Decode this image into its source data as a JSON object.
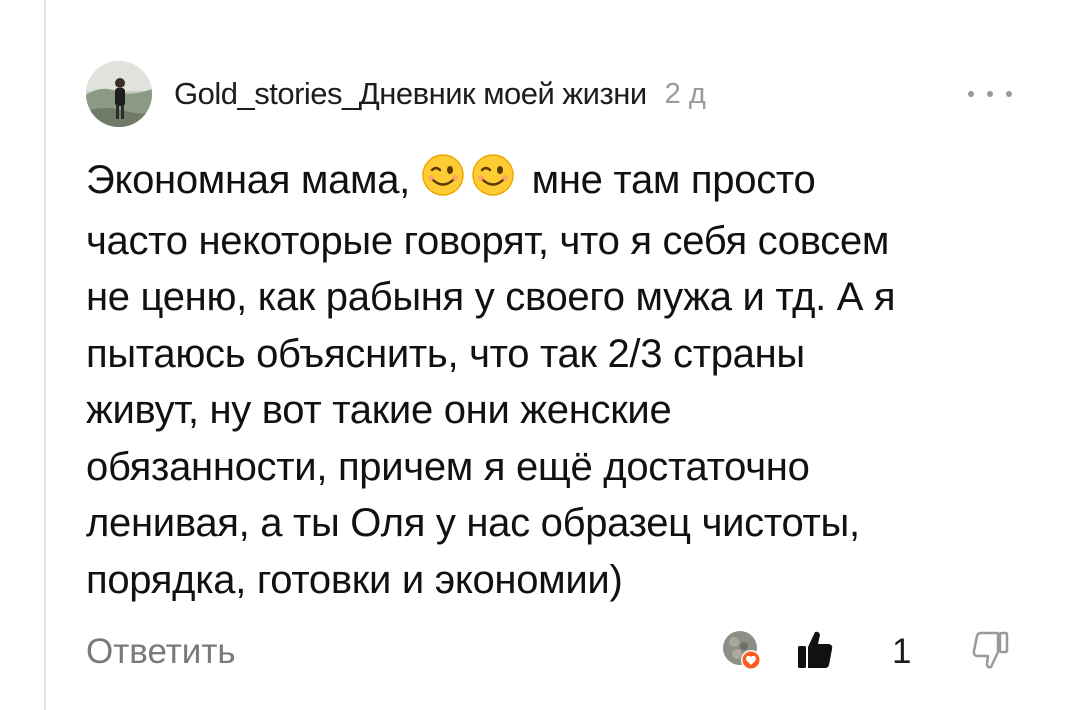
{
  "comment": {
    "author": "Gold_stories_Дневник моей жизни",
    "time": "2 д",
    "more_icon": "more-dots-icon",
    "text_lines": [
      "Экономная мама,",
      "мне там просто",
      "часто некоторые говорят, что я себя совсем",
      "не ценю, как рабыня у своего мужа и тд. А я",
      "пытаюсь объяснить, что так 2/3 страны",
      "живут, ну вот такие они женские",
      "обязанности, причем я ещё достаточно",
      "ленивая, а ты Оля у нас образец чистоты,",
      "порядка, готовки и экономии)"
    ],
    "emoji": [
      "😉",
      "😉"
    ]
  },
  "footer": {
    "reply_label": "Ответить",
    "like_count": "1",
    "like_icon": "thumbs-up-icon",
    "dislike_icon": "thumbs-down-icon",
    "reaction_icon": "heart-icon"
  },
  "colors": {
    "text": "#111111",
    "muted": "#9a9a9a",
    "reaction": "#ff5a1f"
  }
}
